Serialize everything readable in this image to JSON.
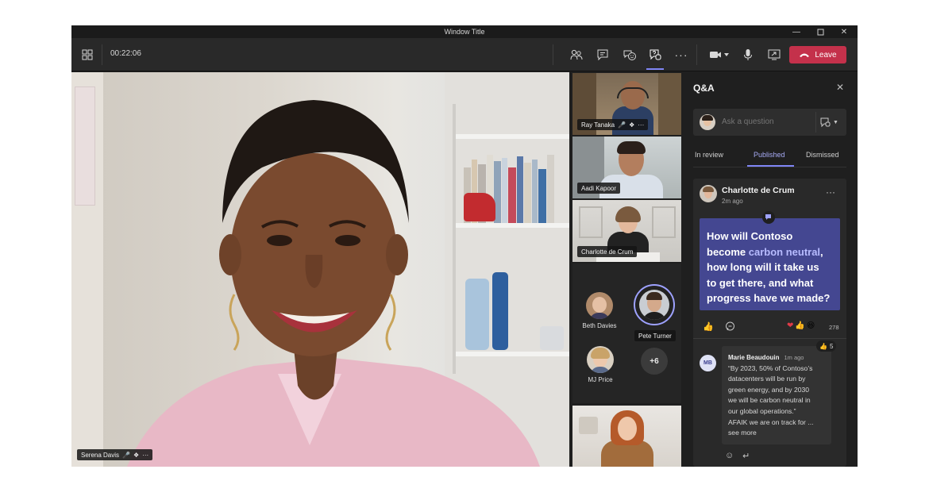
{
  "window": {
    "title": "Window Title"
  },
  "toolbar": {
    "timer": "00:22:06",
    "leave_label": "Leave"
  },
  "main": {
    "speaker_name": "Serena Davis"
  },
  "tiles": [
    {
      "name": "Ray Tanaka"
    },
    {
      "name": "Aadi Kapoor"
    },
    {
      "name": "Charlotte de Crum"
    }
  ],
  "avatars": [
    {
      "name": "Beth Davies"
    },
    {
      "name": "Pete Turner"
    },
    {
      "name": "MJ Price"
    }
  ],
  "overflow_count": "+6",
  "qa": {
    "title": "Q&A",
    "ask_placeholder": "Ask a question",
    "tabs": [
      "In review",
      "Published",
      "Dismissed"
    ],
    "post": {
      "author": "Charlotte de Crum",
      "time": "2m ago",
      "question_lines": [
        "How will Contoso",
        "become ",
        "carbon neutral",
        ",",
        "how long will it take us",
        "to get there, and what",
        "progress have we made?"
      ],
      "reaction_count": "278"
    },
    "reply": {
      "initials": "MB",
      "author": "Marie Beaudouin",
      "time": "1m ago",
      "lines": [
        "“By 2023, 50% of Contoso’s",
        "datacenters will be run by",
        "green energy, and by 2030",
        "we will be carbon neutral in",
        "our global operations.”",
        "AFAIK we are on track for ...",
        "see more"
      ],
      "like_count": "5"
    }
  },
  "colors": {
    "accent": "#7f85f5",
    "leave": "#c4314b",
    "question_bg": "#444791"
  }
}
